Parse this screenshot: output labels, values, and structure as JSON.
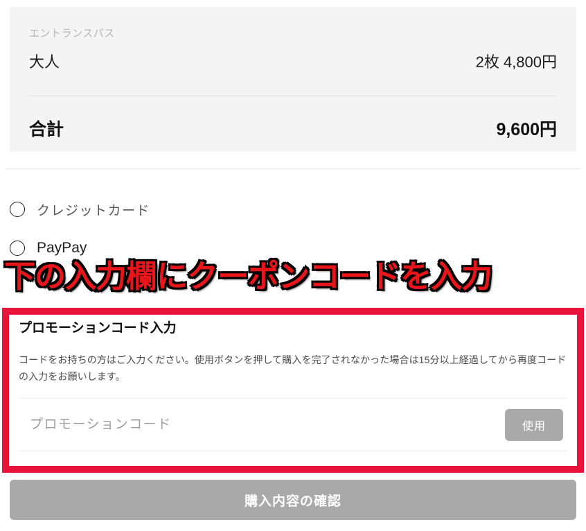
{
  "summary": {
    "group_label": "エントランスパス",
    "items": [
      {
        "name": "大人",
        "price": "2枚 4,800円"
      }
    ],
    "total_label": "合計",
    "total_value": "9,600円"
  },
  "payment": {
    "options": [
      {
        "label": "クレジットカード",
        "selected": false
      },
      {
        "label": "PayPay",
        "selected": false
      }
    ]
  },
  "annotation": {
    "text": "下の入力欄にクーポンコードを入力",
    "color": "#e8161b",
    "outline_color": "#000000"
  },
  "promo": {
    "title": "プロモーションコード入力",
    "description": "コードをお持ちの方はご入力ください。使用ボタンを押して購入を完了されなかった場合は15分以上経過してから再度コードの入力をお願いします。",
    "input_value": "",
    "input_placeholder": "プロモーションコード",
    "apply_label": "使用",
    "border_color": "#e8143c",
    "apply_button_color": "#a9a9a9"
  },
  "footer": {
    "confirm_label": "購入内容の確認",
    "confirm_button_color": "#a9a9a9"
  }
}
